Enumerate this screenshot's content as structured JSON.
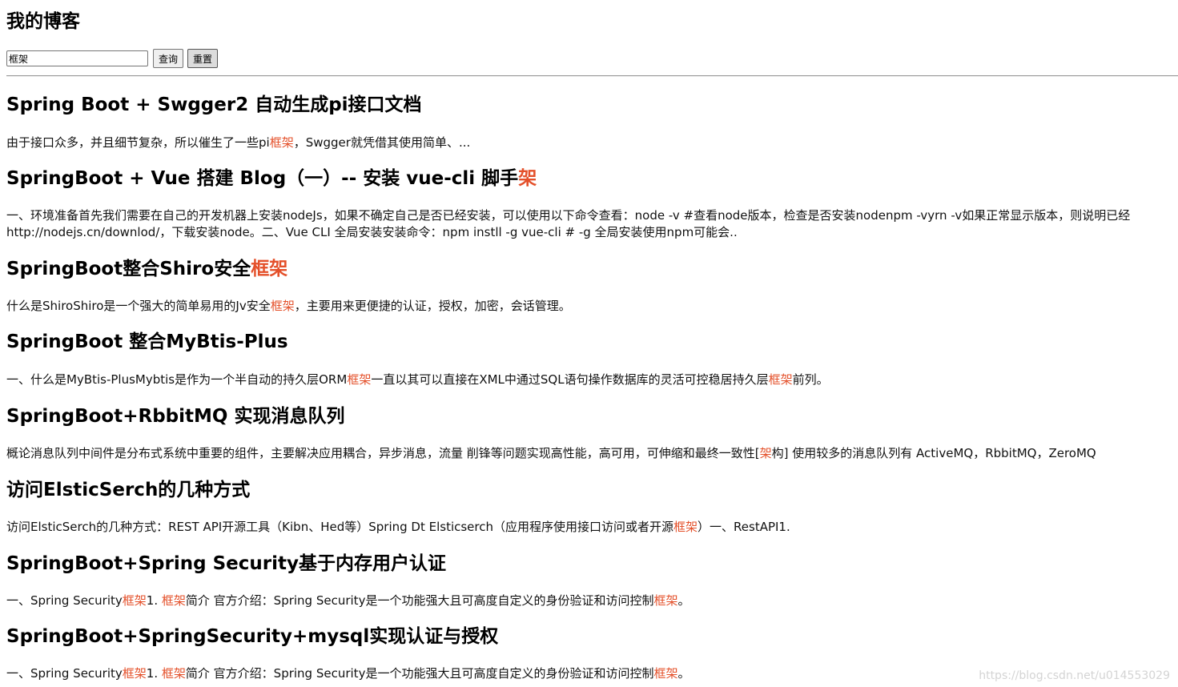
{
  "site": {
    "title": "我的博客"
  },
  "search": {
    "value": "框架",
    "query_button": "查询",
    "reset_button": "重置"
  },
  "highlight_color": "#e4502a",
  "posts": [
    {
      "title": [
        {
          "t": "Spring Boot + Swgger2 自动生成pi接口文档"
        }
      ],
      "summary": [
        {
          "t": "由于接口众多，并且细节复杂，所以催生了一些pi"
        },
        {
          "t": "框架",
          "hl": true
        },
        {
          "t": "，Swgger就凭借其使用简单、..."
        }
      ]
    },
    {
      "title": [
        {
          "t": "SpringBoot + Vue 搭建 Blog（一）-- 安装 vue-cli 脚手"
        },
        {
          "t": "架",
          "hl": true
        }
      ],
      "summary": [
        {
          "t": "一、环境准备首先我们需要在自己的开发机器上安装nodeJs，如果不确定自己是否已经安装，可以使用以下命令查看：node -v #查看node版本，检查是否安装nodenpm -vyrn -v如果正常显示版本，则说明已经 http://nodejs.cn/downlod/，下载安装node。二、Vue CLI 全局安装安装命令：npm instll -g vue-cli # -g 全局安装使用npm可能会.."
        }
      ]
    },
    {
      "title": [
        {
          "t": "SpringBoot整合Shiro安全"
        },
        {
          "t": "框架",
          "hl": true
        }
      ],
      "summary": [
        {
          "t": "什么是ShiroShiro是一个强大的简单易用的Jv安全"
        },
        {
          "t": "框架",
          "hl": true
        },
        {
          "t": "，主要用来更便捷的认证，授权，加密，会话管理。"
        }
      ]
    },
    {
      "title": [
        {
          "t": "SpringBoot 整合MyBtis-Plus"
        }
      ],
      "summary": [
        {
          "t": "一、什么是MyBtis-PlusMybtis是作为一个半自动的持久层ORM"
        },
        {
          "t": "框架",
          "hl": true
        },
        {
          "t": "一直以其可以直接在XML中通过SQL语句操作数据库的灵活可控稳居持久层"
        },
        {
          "t": "框架",
          "hl": true
        },
        {
          "t": "前列。"
        }
      ]
    },
    {
      "title": [
        {
          "t": "SpringBoot+RbbitMQ 实现消息队列"
        }
      ],
      "summary": [
        {
          "t": "概论消息队列中间件是分布式系统中重要的组件，主要解决应用耦合，异步消息，流量 削锋等问题实现高性能，高可用，可伸缩和最终一致性["
        },
        {
          "t": "架",
          "hl": true
        },
        {
          "t": "构] 使用较多的消息队列有 ActiveMQ，RbbitMQ，ZeroMQ"
        }
      ]
    },
    {
      "title": [
        {
          "t": "访问ElsticSerch的几种方式"
        }
      ],
      "summary": [
        {
          "t": "访问ElsticSerch的几种方式：REST API开源工具（Kibn、Hed等）Spring Dt Elsticserch（应用程序使用接口访问或者开源"
        },
        {
          "t": "框架",
          "hl": true
        },
        {
          "t": "）一、RestAPI1."
        }
      ]
    },
    {
      "title": [
        {
          "t": "SpringBoot+Spring Security基于内存用户认证"
        }
      ],
      "summary": [
        {
          "t": "一、Spring Security"
        },
        {
          "t": "框架",
          "hl": true
        },
        {
          "t": "1. "
        },
        {
          "t": "框架",
          "hl": true
        },
        {
          "t": "简介 官方介绍：Spring Security是一个功能强大且可高度自定义的身份验证和访问控制"
        },
        {
          "t": "框架",
          "hl": true
        },
        {
          "t": "。"
        }
      ]
    },
    {
      "title": [
        {
          "t": "SpringBoot+SpringSecurity+mysql实现认证与授权"
        }
      ],
      "summary": [
        {
          "t": "一、Spring Security"
        },
        {
          "t": "框架",
          "hl": true
        },
        {
          "t": "1. "
        },
        {
          "t": "框架",
          "hl": true
        },
        {
          "t": "简介 官方介绍：Spring Security是一个功能强大且可高度自定义的身份验证和访问控制"
        },
        {
          "t": "框架",
          "hl": true
        },
        {
          "t": "。"
        }
      ]
    }
  ],
  "watermark": "https://blog.csdn.net/u014553029"
}
